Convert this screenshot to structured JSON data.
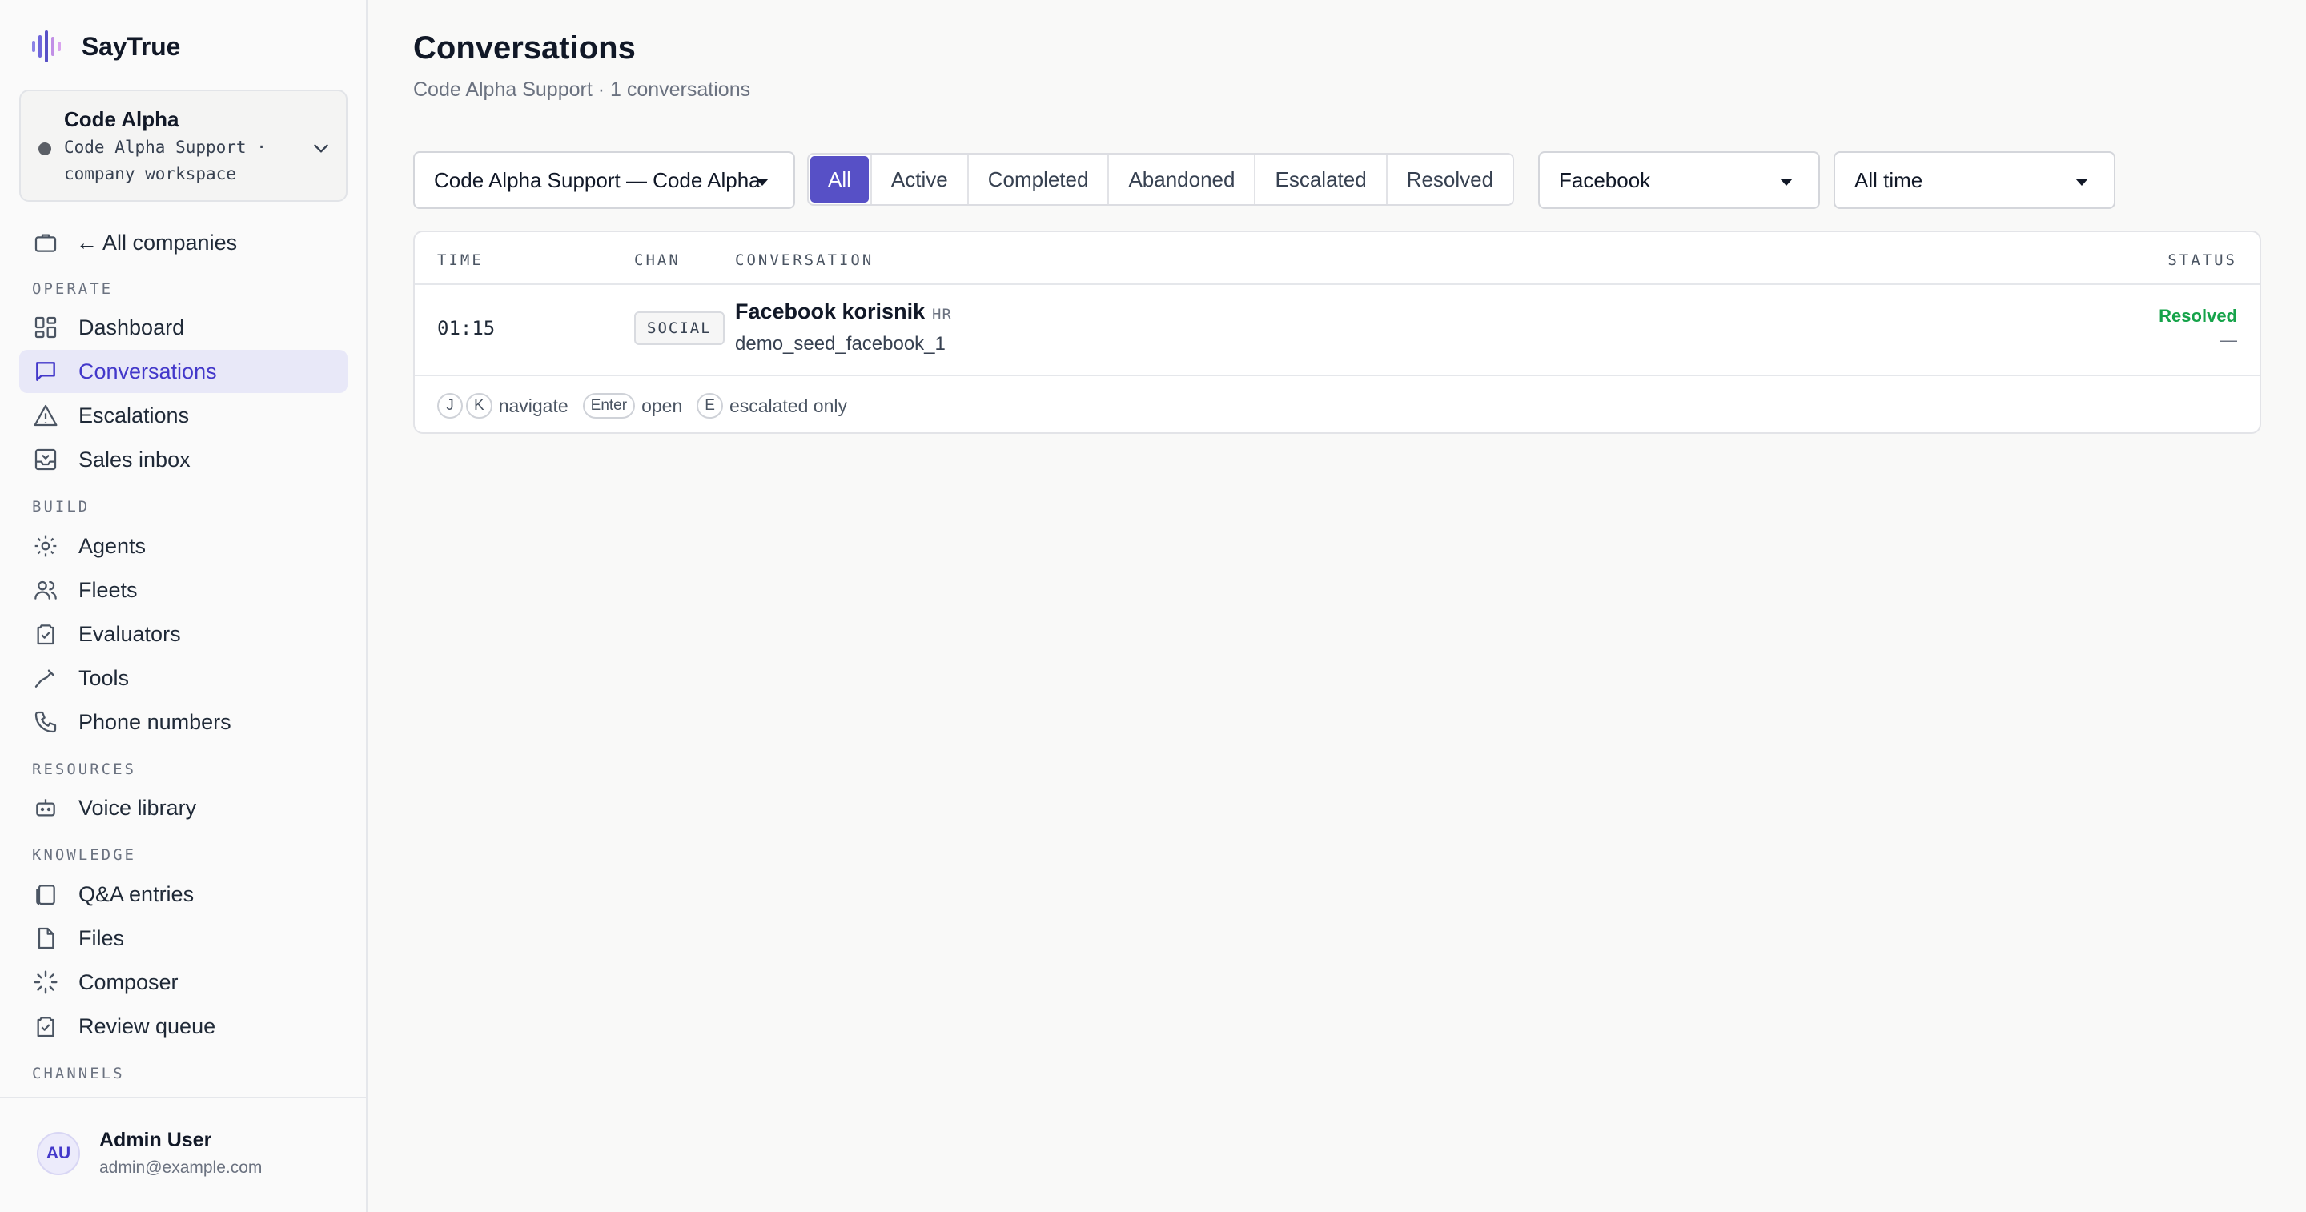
{
  "brand": {
    "name": "SayTrue",
    "logo_icon": "sound-wave-logo",
    "accent": "#5750c6"
  },
  "workspace": {
    "name": "Code Alpha",
    "subtitle": "Code Alpha Support · company workspace"
  },
  "sidebar": {
    "back_link": "← All companies",
    "sections": {
      "operate": "OPERATE",
      "build": "BUILD",
      "resources": "RESOURCES",
      "knowledge": "KNOWLEDGE",
      "channels": "CHANNELS"
    },
    "items": {
      "dashboard": "Dashboard",
      "conversations": "Conversations",
      "escalations": "Escalations",
      "sales_inbox": "Sales inbox",
      "agents": "Agents",
      "fleets": "Fleets",
      "evaluators": "Evaluators",
      "tools": "Tools",
      "phone_numbers": "Phone numbers",
      "voice_library": "Voice library",
      "qa_entries": "Q&A entries",
      "files": "Files",
      "composer": "Composer",
      "review_queue": "Review queue"
    },
    "active": "conversations"
  },
  "user": {
    "initials": "AU",
    "name": "Admin User",
    "email": "admin@example.com"
  },
  "page": {
    "title": "Conversations",
    "subtitle": "Code Alpha Support · 1 conversations"
  },
  "filters": {
    "fleet_select": "Code Alpha Support — Code Alpha",
    "status_tabs": [
      "All",
      "Active",
      "Completed",
      "Abandoned",
      "Escalated",
      "Resolved"
    ],
    "status_active": "All",
    "channel_select": "Facebook",
    "time_select": "All time"
  },
  "table": {
    "columns": {
      "time": "TIME",
      "channel": "CHAN",
      "conversation": "CONVERSATION",
      "status": "STATUS"
    },
    "rows": [
      {
        "time": "01:15",
        "channel": "SOCIAL",
        "name": "Facebook korisnik",
        "lang": "HR",
        "handle": "demo_seed_facebook_1",
        "status": "Resolved",
        "status_detail": "—",
        "status_color": "#16a34a"
      }
    ]
  },
  "hints": {
    "key_j": "J",
    "key_k": "K",
    "navigate": "navigate",
    "key_enter": "Enter",
    "open": "open",
    "key_e": "E",
    "escalated_only": "escalated only"
  }
}
